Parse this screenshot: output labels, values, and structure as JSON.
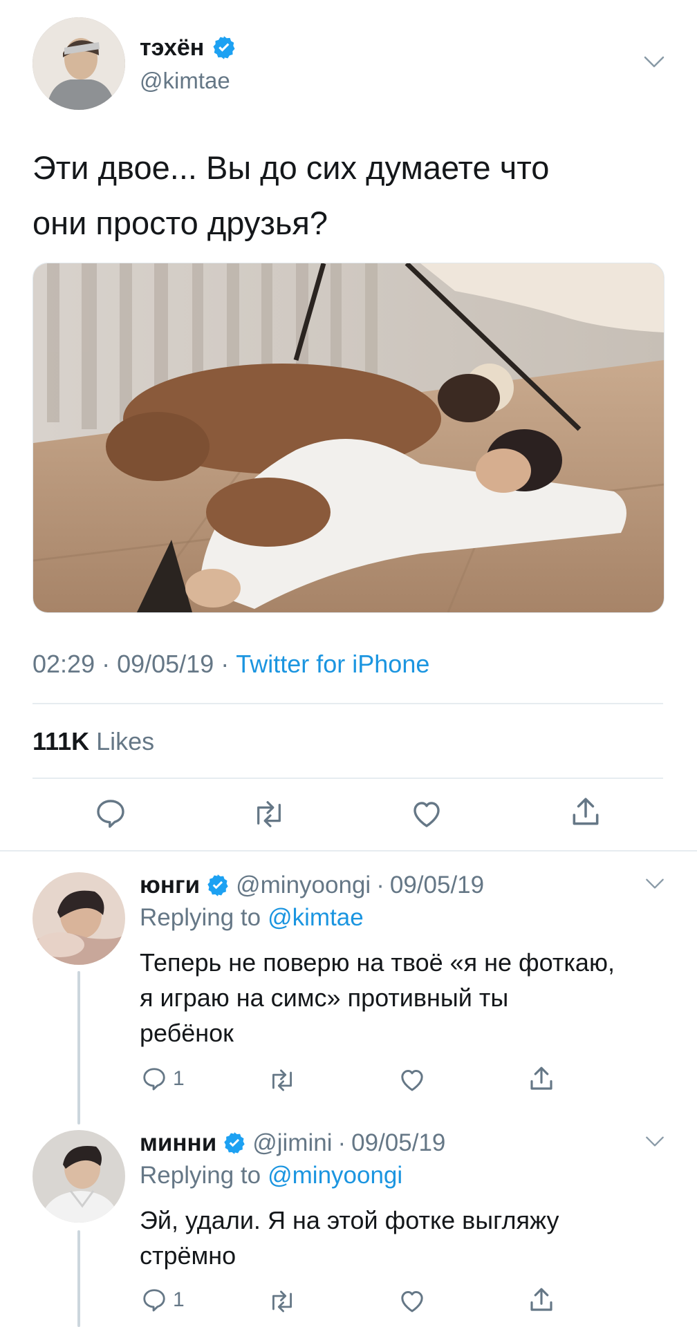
{
  "main_tweet": {
    "author_name": "тэхён",
    "author_handle": "@kimtae",
    "text_line1": "Эти двое... Вы до сих думаете что",
    "text_line2": "они просто друзья?",
    "time": "02:29",
    "date": "09/05/19",
    "source": "Twitter for iPhone",
    "separator": "·",
    "likes_count": "111K",
    "likes_label": "Likes"
  },
  "replies": [
    {
      "author_name": "юнги",
      "author_handle": "@minyoongi",
      "separator": "·",
      "date": "09/05/19",
      "replying_prefix": "Replying to",
      "replying_to": "@kimtae",
      "text_line1": "Теперь не поверю на твоё «я не фоткаю,",
      "text_line2": "я играю на симс» противный ты",
      "text_line3": "ребёнок",
      "reply_count": "1"
    },
    {
      "author_name": "минни",
      "author_handle": "@jimini",
      "separator": "·",
      "date": "09/05/19",
      "replying_prefix": "Replying to",
      "replying_to": "@minyoongi",
      "text_line1": "Эй, удали. Я на этой фотке выгляжу",
      "text_line2": "стрёмно",
      "reply_count": "1"
    }
  ],
  "colors": {
    "text": "#14171a",
    "muted": "#657786",
    "link": "#1b95e0",
    "verified": "#1da1f2",
    "divider": "#e6ecf0"
  }
}
